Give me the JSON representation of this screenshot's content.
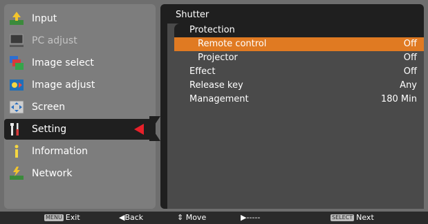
{
  "sidebar": {
    "items": [
      {
        "label": "Input",
        "icon": "input-icon"
      },
      {
        "label": "PC adjust",
        "icon": "pc-adjust-icon"
      },
      {
        "label": "Image select",
        "icon": "image-select-icon"
      },
      {
        "label": "Image adjust",
        "icon": "image-adjust-icon"
      },
      {
        "label": "Screen",
        "icon": "screen-icon"
      },
      {
        "label": "Setting",
        "icon": "setting-icon",
        "active": true
      },
      {
        "label": "Information",
        "icon": "information-icon"
      },
      {
        "label": "Network",
        "icon": "network-icon"
      }
    ]
  },
  "panel": {
    "title": "Shutter",
    "header": "Protection",
    "rows": [
      {
        "label": "Remote control",
        "value": "Off"
      },
      {
        "label": "Projector",
        "value": "Off"
      },
      {
        "label": "Effect",
        "value": "Off"
      },
      {
        "label": "Release key",
        "value": "Any"
      },
      {
        "label": "Management",
        "value": "180 Min"
      }
    ]
  },
  "statusbar": {
    "exit_key": "MENU",
    "exit_label": "Exit",
    "back_label": "◀Back",
    "move_label": "⇕ Move",
    "next_arrow_label": "▶-----",
    "select_key": "SELECT",
    "select_label": "Next"
  },
  "colors": {
    "accent": "#e07a22",
    "pointer": "#e8202a",
    "active_bg": "#1f1f1f",
    "menu_bg": "#7d7d7d"
  }
}
